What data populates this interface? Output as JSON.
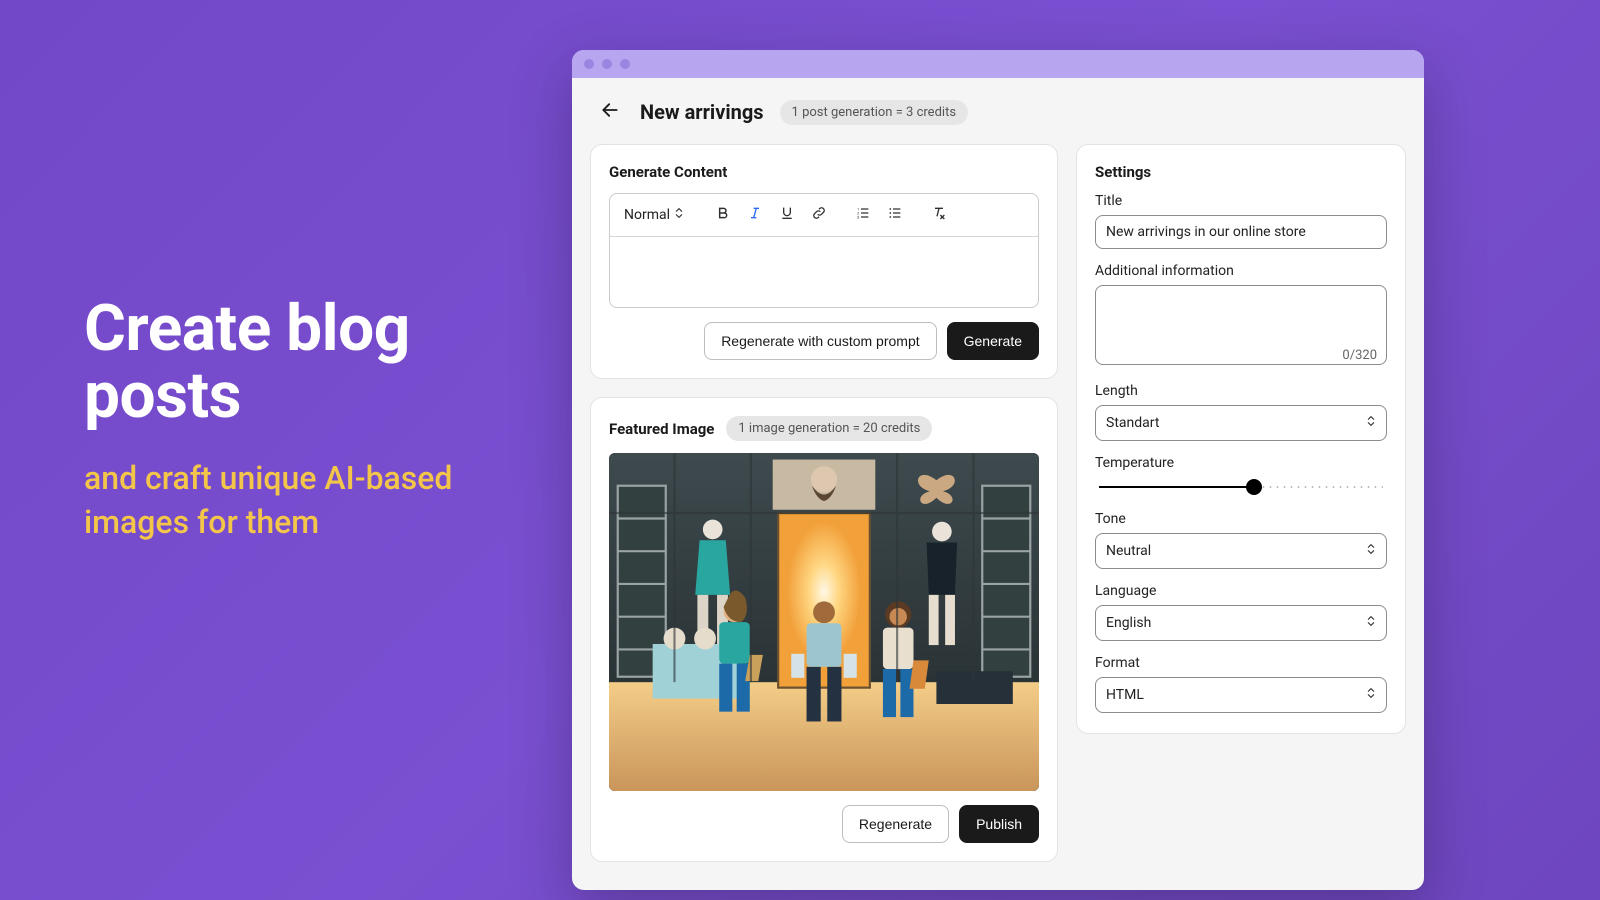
{
  "marketing": {
    "headline": "Create blog posts",
    "subline": "and craft unique AI-based images for them"
  },
  "header": {
    "title": "New arrivings",
    "credits_pill": "1 post generation = 3 credits"
  },
  "content": {
    "heading": "Generate Content",
    "format_select": "Normal",
    "regenerate_custom_label": "Regenerate with custom prompt",
    "generate_label": "Generate"
  },
  "featured": {
    "heading": "Featured Image",
    "credits_pill": "1 image generation = 20 credits",
    "regenerate_label": "Regenerate",
    "publish_label": "Publish"
  },
  "settings": {
    "heading": "Settings",
    "title_label": "Title",
    "title_value": "New arrivings in our online store",
    "additional_label": "Additional information",
    "additional_value": "",
    "additional_counter": "0/320",
    "length_label": "Length",
    "length_value": "Standart",
    "temperature_label": "Temperature",
    "temperature_percent": 53,
    "tone_label": "Tone",
    "tone_value": "Neutral",
    "language_label": "Language",
    "language_value": "English",
    "format_label": "Format",
    "format_value": "HTML"
  }
}
